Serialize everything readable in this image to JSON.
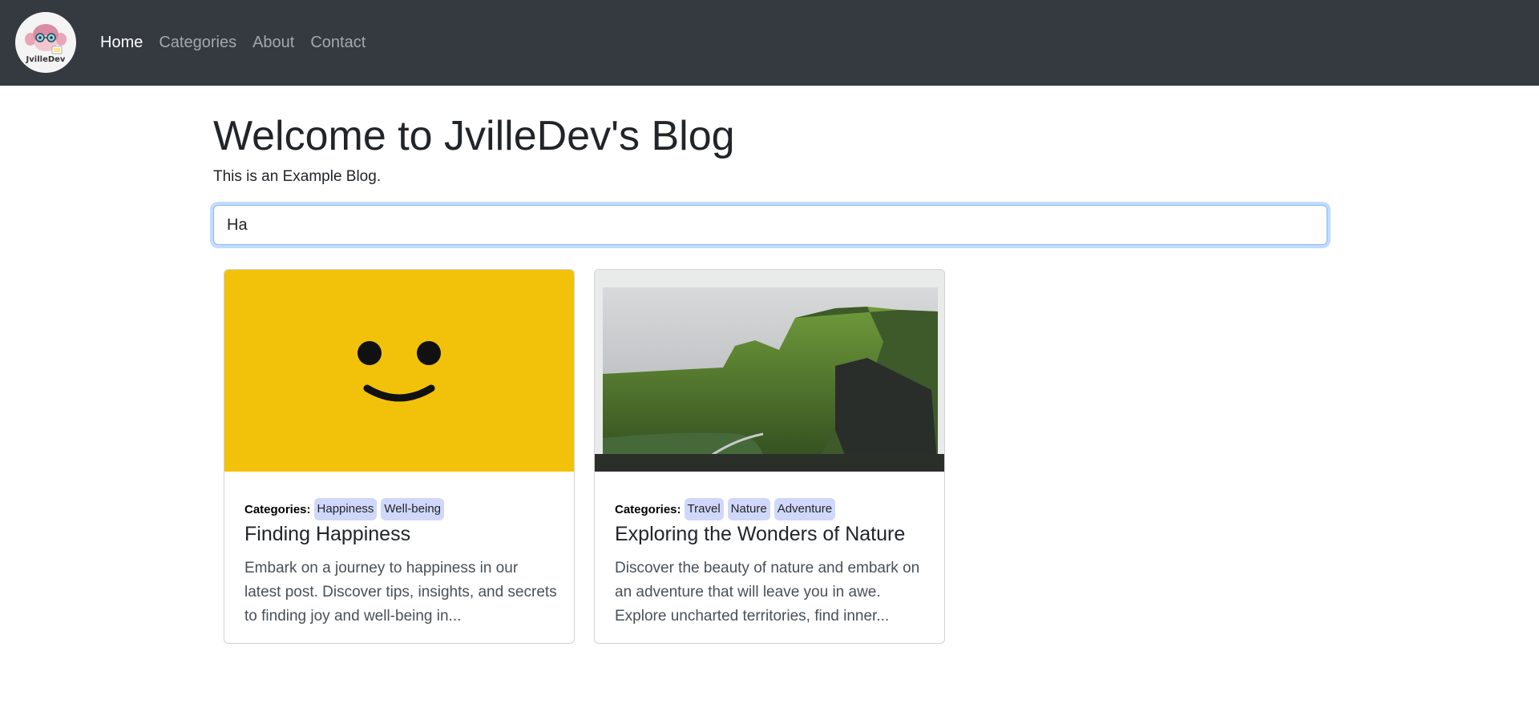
{
  "nav": {
    "logo_text": "JvilleDev",
    "links": [
      {
        "label": "Home",
        "active": true
      },
      {
        "label": "Categories",
        "active": false
      },
      {
        "label": "About",
        "active": false
      },
      {
        "label": "Contact",
        "active": false
      }
    ]
  },
  "header": {
    "title": "Welcome to JvilleDev's Blog",
    "subtitle": "This is an Example Blog."
  },
  "search": {
    "value": "Ha"
  },
  "posts": [
    {
      "categories_label": "Categories:",
      "categories": [
        "Happiness",
        "Well-being"
      ],
      "title": "Finding Happiness",
      "excerpt": "Embark on a journey to happiness in our latest post. Discover tips, insights, and secrets to finding joy and well-being in...",
      "image": "smiley-face-image"
    },
    {
      "categories_label": "Categories:",
      "categories": [
        "Travel",
        "Nature",
        "Adventure"
      ],
      "title": "Exploring the Wonders of Nature",
      "excerpt": "Discover the beauty of nature and embark on an adventure that will leave you in awe. Explore uncharted territories, find inner...",
      "image": "mountain-landscape-image"
    }
  ],
  "colors": {
    "navbar": "#343a40",
    "badge": "#cfd8fb",
    "smiley_bg": "#f2c20a"
  }
}
